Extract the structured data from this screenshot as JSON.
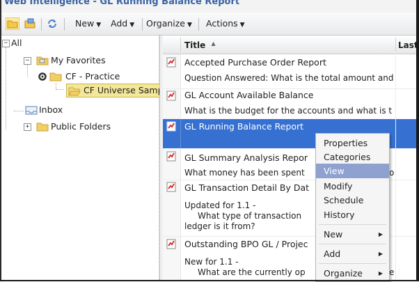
{
  "window": {
    "title": "Web Intelligence - GL Running Balance Report"
  },
  "toolbar": {
    "new_label": "New",
    "add_label": "Add",
    "organize_label": "Organize",
    "actions_label": "Actions"
  },
  "tree": {
    "all": "All",
    "my_favorites": "My Favorites",
    "cf_practice": "CF - Practice",
    "cf_universe": "CF Universe Samp",
    "inbox": "Inbox",
    "public_folders": "Public Folders"
  },
  "list": {
    "columns": {
      "title": "Title",
      "last": "Last"
    },
    "rows": [
      {
        "title": "Accepted Purchase Order Report",
        "desc": "Question Answered: What is the total amount and"
      },
      {
        "title": "GL Account Available Balance",
        "desc": "What is the budget for the accounts and what is t"
      },
      {
        "title": "GL Running Balance Report"
      },
      {
        "title": "GL Summary Analysis Repor",
        "desc": "What money has been spent",
        "desc_tail": "o"
      },
      {
        "title": "GL Transaction Detail By Dat",
        "desc1": "Updated for 1.1 -",
        "desc2": "What type of transaction",
        "desc3": "ledger is it from?"
      },
      {
        "title": "Outstanding BPO GL / Projec",
        "desc1": "New for 1.1 -",
        "desc2": "What are the currently op",
        "desc_tail": "e"
      }
    ]
  },
  "context_menu": {
    "items": [
      "Properties",
      "Categories",
      "View",
      "Modify",
      "Schedule",
      "History",
      "New",
      "Add",
      "Organize"
    ],
    "highlighted": "View"
  },
  "colors": {
    "selection": "#3670d1",
    "menu_highlight": "#8ea1cf",
    "title_text": "#3b63a3"
  }
}
